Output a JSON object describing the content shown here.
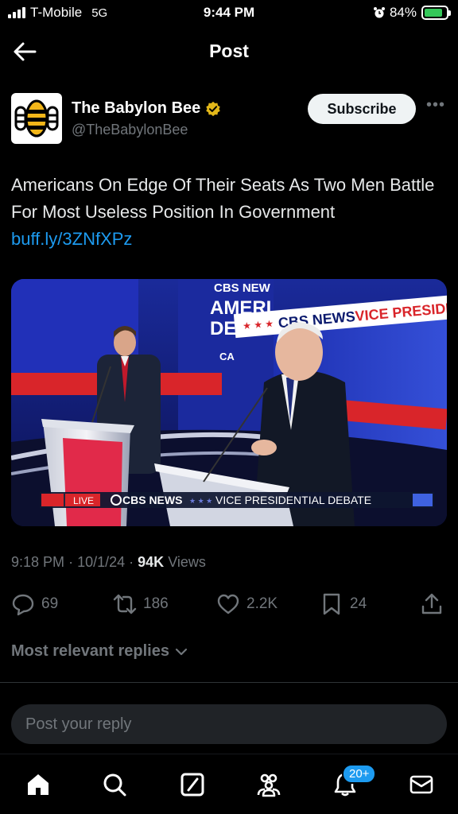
{
  "status_bar": {
    "carrier": "T-Mobile",
    "network": "5G",
    "time": "9:44 PM",
    "battery": "84%",
    "battery_level": 0.84,
    "battery_color": "#34c759"
  },
  "header": {
    "title": "Post",
    "back_icon": "arrow-left-icon"
  },
  "post": {
    "author_name": "The Babylon Bee",
    "author_handle": "@TheBabylonBee",
    "verified_color": "#e2b719",
    "subscribe_label": "Subscribe",
    "more_label": "•••",
    "text": "Americans On Edge Of Their Seats As Two Men Battle For Most Useless Position In Government",
    "link": "buff.ly/3ZNfXPz",
    "media": {
      "chyron_live": "LIVE",
      "chyron_network": "CBS NEWS",
      "chyron_title": "VICE PRESIDENTIAL DEBATE",
      "banner_network": "CBS NEWS",
      "banner_text": "VICE PRESIDE",
      "backdrop_top": "CBS NEW",
      "backdrop_line1": "AMERI",
      "backdrop_line2": "DE",
      "backdrop_line3": "CA"
    },
    "time": "9:18 PM",
    "date": "10/1/24",
    "views_count": "94K",
    "views_label": "Views"
  },
  "actions": {
    "replies": "69",
    "reposts": "186",
    "likes": "2.2K",
    "bookmarks": "24"
  },
  "replies_sort_label": "Most relevant replies",
  "reply_placeholder": "Post your reply",
  "nav": {
    "notifications_badge": "20+",
    "accent_color": "#1d9bf0"
  }
}
